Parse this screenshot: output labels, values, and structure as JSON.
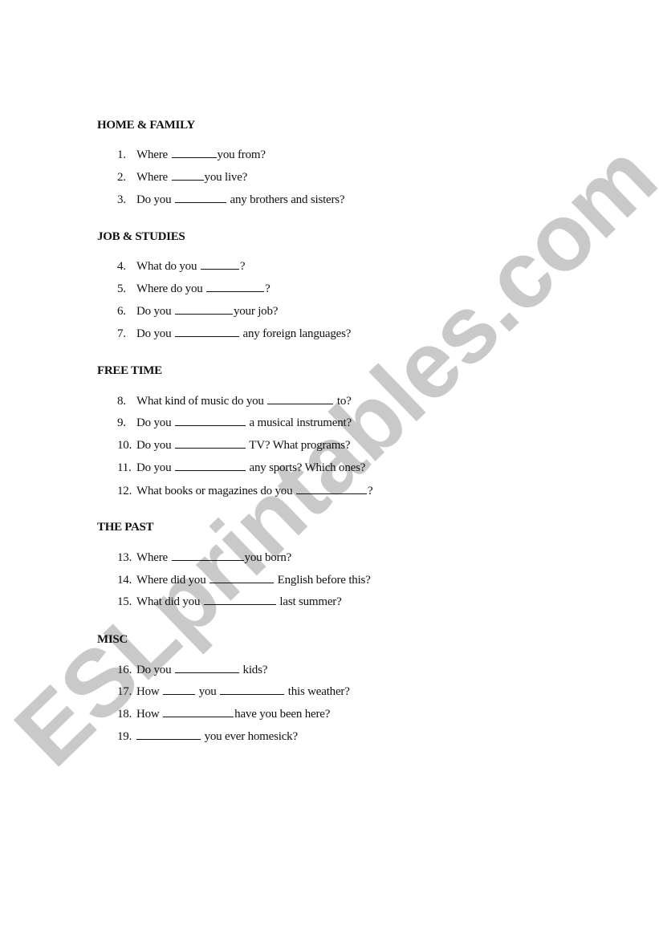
{
  "watermark": "ESLprintables.com",
  "sections": [
    {
      "heading": "HOME & FAMILY",
      "questions": [
        {
          "number": "1.",
          "parts": [
            "Where",
            "",
            "you from?"
          ]
        },
        {
          "number": "2.",
          "parts": [
            "Where",
            "",
            "you live?"
          ]
        },
        {
          "number": "3.",
          "parts": [
            "Do you",
            "",
            "any brothers and sisters?"
          ]
        }
      ]
    },
    {
      "heading": "JOB & STUDIES",
      "questions": [
        {
          "number": "4.",
          "parts": [
            "What do you",
            "",
            "?"
          ]
        },
        {
          "number": "5.",
          "parts": [
            "Where do you",
            "",
            "?"
          ]
        },
        {
          "number": "6.",
          "parts": [
            "Do you",
            "",
            "your job?"
          ]
        },
        {
          "number": "7.",
          "parts": [
            "Do you",
            "",
            "any foreign languages?"
          ]
        }
      ]
    },
    {
      "heading": "FREE TIME",
      "questions": [
        {
          "number": "8.",
          "parts": [
            "What kind of music do you",
            "",
            "to?"
          ]
        },
        {
          "number": "9.",
          "parts": [
            "Do you",
            "",
            "a musical instrument?"
          ]
        },
        {
          "number": "10.",
          "parts": [
            "Do you",
            "",
            "TV? What programs?"
          ]
        },
        {
          "number": "11.",
          "parts": [
            "Do you",
            "",
            "any sports? Which ones?"
          ]
        },
        {
          "number": "12.",
          "parts": [
            "What books or magazines do you",
            "",
            "?"
          ]
        }
      ]
    },
    {
      "heading": "THE PAST",
      "questions": [
        {
          "number": "13.",
          "parts": [
            "Where",
            "",
            "you born?"
          ]
        },
        {
          "number": "14.",
          "parts": [
            "Where did you",
            "",
            "English before this?"
          ]
        },
        {
          "number": "15.",
          "parts": [
            "What did you",
            "",
            "last summer?"
          ]
        }
      ]
    },
    {
      "heading": "MISC",
      "questions": [
        {
          "number": "16.",
          "parts": [
            "Do you",
            "",
            "kids?"
          ]
        },
        {
          "number": "17.",
          "parts": [
            "How",
            "",
            "you",
            "",
            "this weather?"
          ]
        },
        {
          "number": "18.",
          "parts": [
            "How",
            "",
            "have you been here?"
          ]
        },
        {
          "number": "19.",
          "parts": [
            "",
            "",
            "you ever homesick?"
          ]
        }
      ]
    }
  ]
}
